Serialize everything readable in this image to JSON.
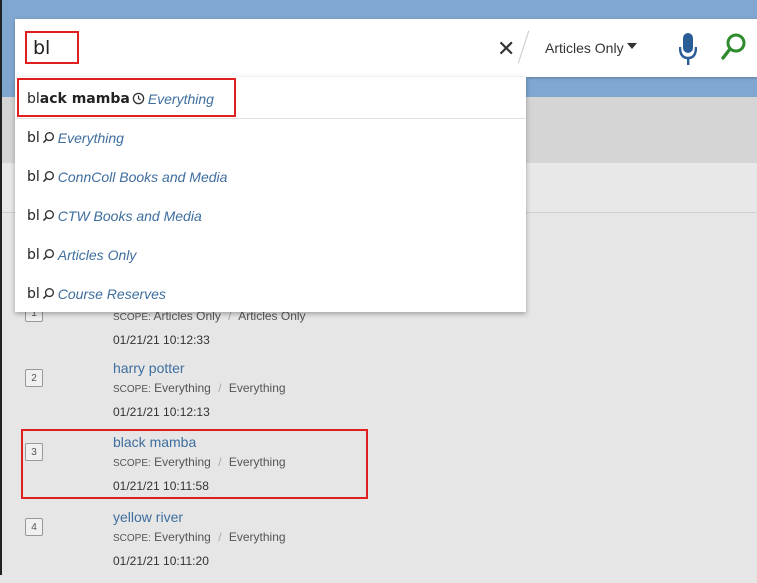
{
  "search": {
    "query": "bl",
    "clear_glyph": "✕",
    "scope_selected": "Articles Only",
    "mic_icon": "microphone-icon",
    "search_icon": "search-icon"
  },
  "suggestions": [
    {
      "prefix": "bl",
      "rest": "ack mamba",
      "scope": "Everything",
      "icon": "history-clock-icon"
    },
    {
      "text": "bl",
      "scope": "Everything",
      "icon": "search-icon"
    },
    {
      "text": "bl",
      "scope": "ConnColl Books and Media",
      "icon": "search-icon"
    },
    {
      "text": "bl",
      "scope": "CTW Books and Media",
      "icon": "search-icon"
    },
    {
      "text": "bl",
      "scope": "Articles Only",
      "icon": "search-icon"
    },
    {
      "text": "bl",
      "scope": "Course Reserves",
      "icon": "search-icon"
    }
  ],
  "history": [
    {
      "index": "1",
      "scope_label": "SCOPE:",
      "scope_a": "Articles Only",
      "scope_b": "Articles Only",
      "time": "01/21/21 10:12:33"
    },
    {
      "index": "2",
      "title": "harry potter",
      "scope_label": "SCOPE:",
      "scope_a": "Everything",
      "scope_b": "Everything",
      "time": "01/21/21 10:12:13"
    },
    {
      "index": "3",
      "title": "black mamba",
      "scope_label": "SCOPE:",
      "scope_a": "Everything",
      "scope_b": "Everything",
      "time": "01/21/21 10:11:58"
    },
    {
      "index": "4",
      "title": "yellow river",
      "scope_label": "SCOPE:",
      "scope_a": "Everything",
      "scope_b": "Everything",
      "time": "01/21/21 10:11:20"
    }
  ],
  "history_separator": "/",
  "colors": {
    "accent_link": "#3e6e9e",
    "highlight_red": "#e02020",
    "topbar_blue": "#7fa7d0",
    "search_green": "#2e8b2e",
    "mic_blue": "#2a5d96"
  }
}
